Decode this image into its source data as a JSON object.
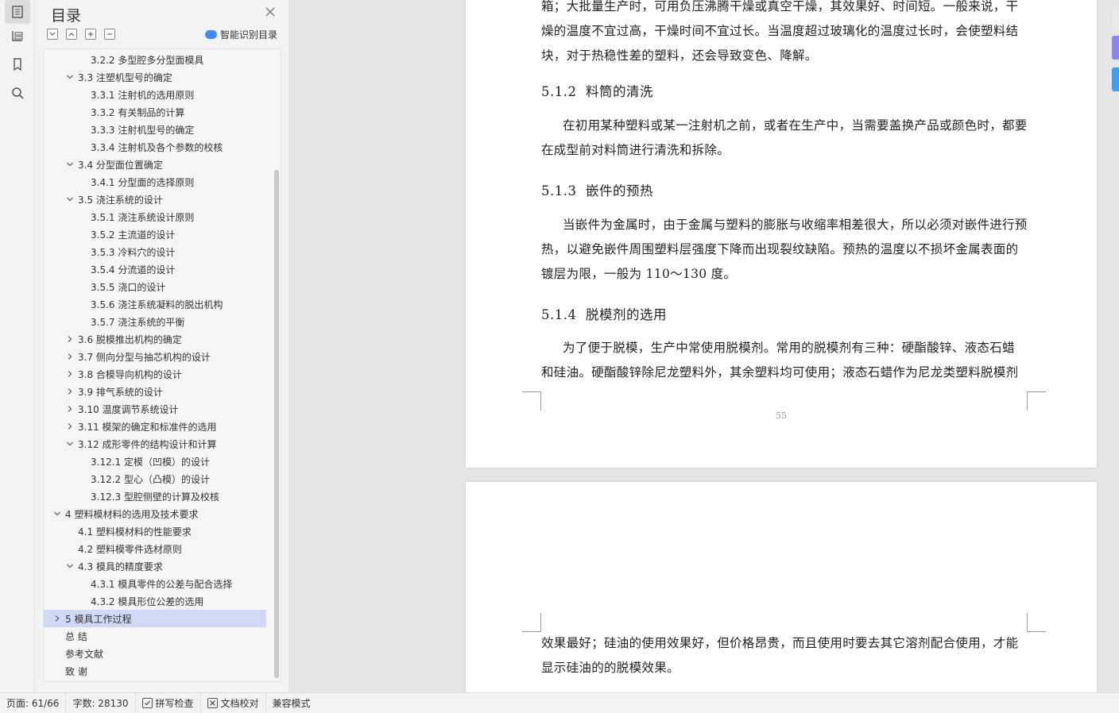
{
  "sidebar": {
    "rail_icons": [
      "toc-icon",
      "navigation-icon",
      "bookmark-icon",
      "search-icon"
    ],
    "title": "目录",
    "smart_toc_label": "智能识别目录",
    "items": [
      {
        "text": "3.2.2  多型腔多分型面模具",
        "level": 3,
        "toggle": "none"
      },
      {
        "text": "3.3  注塑机型号的确定",
        "level": 2,
        "toggle": "open"
      },
      {
        "text": "3.3.1  注射机的选用原则",
        "level": 3,
        "toggle": "none"
      },
      {
        "text": "3.3.2  有关制品的计算",
        "level": 3,
        "toggle": "none"
      },
      {
        "text": "3.3.3  注射机型号的确定",
        "level": 3,
        "toggle": "none"
      },
      {
        "text": "3.3.4  注射机及各个参数的校核",
        "level": 3,
        "toggle": "none"
      },
      {
        "text": "3.4  分型面位置确定",
        "level": 2,
        "toggle": "open"
      },
      {
        "text": "3.4.1  分型面的选择原则",
        "level": 3,
        "toggle": "none"
      },
      {
        "text": "3.5  浇注系统的设计",
        "level": 2,
        "toggle": "open"
      },
      {
        "text": "3.5.1 浇注系统设计原则",
        "level": 3,
        "toggle": "none"
      },
      {
        "text": "3.5.2  主流道的设计",
        "level": 3,
        "toggle": "none"
      },
      {
        "text": "3.5.3 冷料穴的设计",
        "level": 3,
        "toggle": "none"
      },
      {
        "text": "3.5.4  分流道的设计",
        "level": 3,
        "toggle": "none"
      },
      {
        "text": "3.5.5 浇口的设计",
        "level": 3,
        "toggle": "none"
      },
      {
        "text": "3.5.6  浇注系统凝料的脱出机构",
        "level": 3,
        "toggle": "none"
      },
      {
        "text": "3.5.7  浇注系统的平衡",
        "level": 3,
        "toggle": "none"
      },
      {
        "text": "3.6  脱模推出机构的确定",
        "level": 2,
        "toggle": "closed"
      },
      {
        "text": "3.7  侧向分型与抽芯机构的设计",
        "level": 2,
        "toggle": "closed"
      },
      {
        "text": "3.8  合模导向机构的设计",
        "level": 2,
        "toggle": "closed"
      },
      {
        "text": "3.9  排气系统的设计",
        "level": 2,
        "toggle": "closed"
      },
      {
        "text": "3.10  温度调节系统设计",
        "level": 2,
        "toggle": "closed"
      },
      {
        "text": "3.11  模架的确定和标准件的选用",
        "level": 2,
        "toggle": "closed"
      },
      {
        "text": "3.12  成形零件的结构设计和计算",
        "level": 2,
        "toggle": "open"
      },
      {
        "text": "3.12.1  定模（凹模）的设计",
        "level": 3,
        "toggle": "none"
      },
      {
        "text": "3.12.2    型心（凸模）的设计",
        "level": 3,
        "toggle": "none"
      },
      {
        "text": "3.12.3    型腔侧壁的计算及校核",
        "level": 3,
        "toggle": "none"
      },
      {
        "text": "4  塑料模材料的选用及技术要求",
        "level": 1,
        "toggle": "open"
      },
      {
        "text": "4.1  塑料模材料的性能要求",
        "level": 2,
        "toggle": "none"
      },
      {
        "text": "4.2  塑料模零件选材原则",
        "level": 2,
        "toggle": "none"
      },
      {
        "text": "4.3  模具的精度要求",
        "level": 2,
        "toggle": "open"
      },
      {
        "text": "4.3.1  模具零件的公差与配合选择",
        "level": 3,
        "toggle": "none"
      },
      {
        "text": "4.3.2  模具形位公差的选用",
        "level": 3,
        "toggle": "none"
      },
      {
        "text": "5 模具工作过程",
        "level": 1,
        "toggle": "closed",
        "selected": true
      },
      {
        "text": "总    结",
        "level": 1,
        "toggle": "none"
      },
      {
        "text": "参考文献",
        "level": 1,
        "toggle": "none"
      },
      {
        "text": "致    谢",
        "level": 1,
        "toggle": "none"
      }
    ]
  },
  "document": {
    "page1": {
      "para0_lines": [
        "箱；大批量生产时，可用负压沸腾干燥或真空干燥，其效果好、时间短。一般来说，干",
        "燥的温度不宜过高，干燥时间不宜过长。当温度超过玻璃化的温度过长时，会使塑料结",
        "块，对于热稳性差的塑料，还会导致变色、降解。"
      ],
      "h512_num": "5.1.2",
      "h512_title": "料筒的清洗",
      "para1_lines": [
        "在初用某种塑料或某一注射机之前，或者在生产中，当需要盖换产品或颜色时，都要",
        "在成型前对料筒进行清洗和拆除。"
      ],
      "h513_num": "5.1.3",
      "h513_title": "嵌件的预热",
      "para2_lines": [
        "当嵌件为金属时，由于金属与塑料的膨胀与收缩率相差很大，所以必须对嵌件进行预",
        "热，以避免嵌件周围塑料层强度下降而出现裂纹缺陷。预热的温度以不损坏金属表面的",
        "镀层为限，一般为 110～130 度。"
      ],
      "h514_num": "5.1.4",
      "h514_title": "脱模剂的选用",
      "para3_lines": [
        " 为了便于脱模，生产中常使用脱模剂。常用的脱模剂有三种：硬酯酸锌、液态石蜡",
        "和硅油。硬酯酸锌除尼龙塑料外，其余塑料均可使用；液态石蜡作为尼龙类塑料脱模剂"
      ],
      "page_number": "55"
    },
    "page2": {
      "para_lines": [
        "效果最好；硅油的使用效果好，但价格昂贵，而且使用时要去其它溶剂配合使用，才能",
        "显示硅油的的脱模效果。"
      ]
    }
  },
  "statusbar": {
    "page": "页面: 61/66",
    "words": "字数: 28130",
    "spell": "拼写检查",
    "proof": "文档校对",
    "compat": "兼容模式"
  },
  "colors": {
    "selected_bg": "#cfd9f3",
    "accent": "#3f8cf7",
    "right_tab_purple": "#8b86f5",
    "right_tab_blue": "#3e9cf5"
  }
}
